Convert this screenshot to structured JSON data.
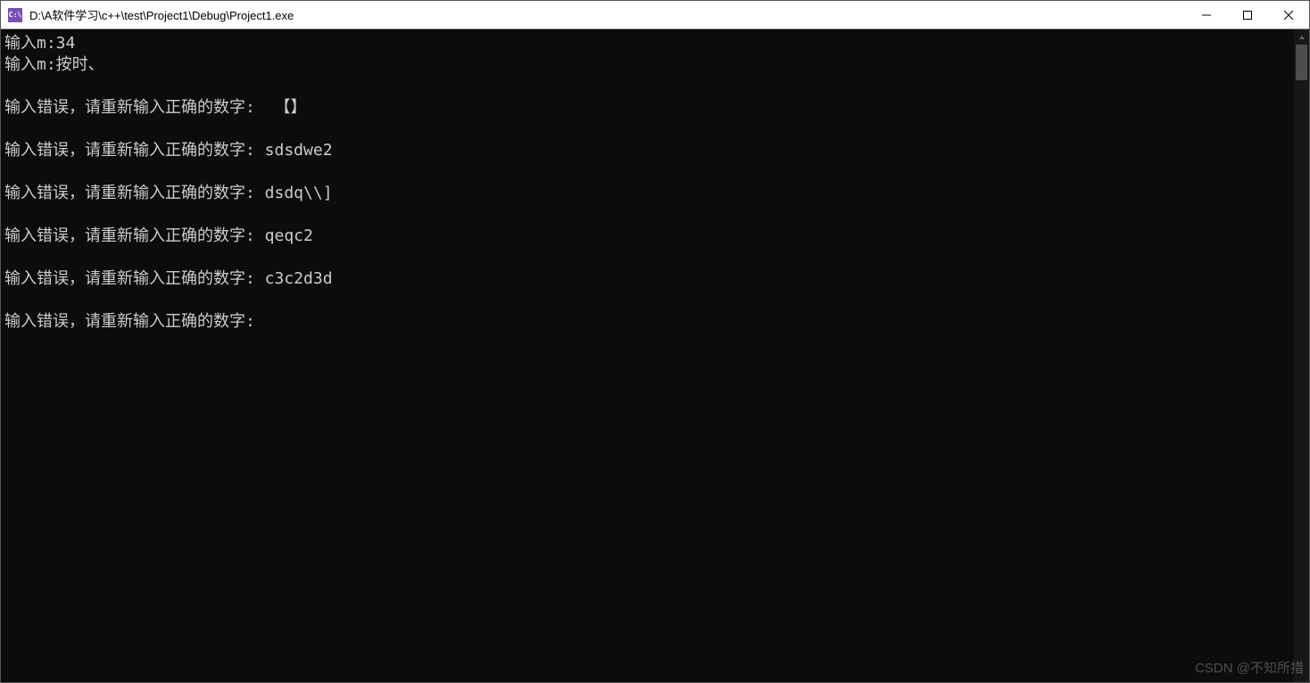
{
  "titlebar": {
    "icon_text": "C:\\",
    "title": "D:\\A软件学习\\c++\\test\\Project1\\Debug\\Project1.exe"
  },
  "console": {
    "lines": [
      "输入m:34",
      "输入m:按时、",
      "",
      "输入错误，请重新输入正确的数字:  【】",
      "",
      "输入错误，请重新输入正确的数字: sdsdwe2",
      "",
      "输入错误，请重新输入正确的数字: dsdq\\\\]",
      "",
      "输入错误，请重新输入正确的数字: qeqc2",
      "",
      "输入错误，请重新输入正确的数字: c3c2d3d",
      "",
      "输入错误，请重新输入正确的数字:"
    ]
  },
  "watermark": "CSDN @不知所措"
}
